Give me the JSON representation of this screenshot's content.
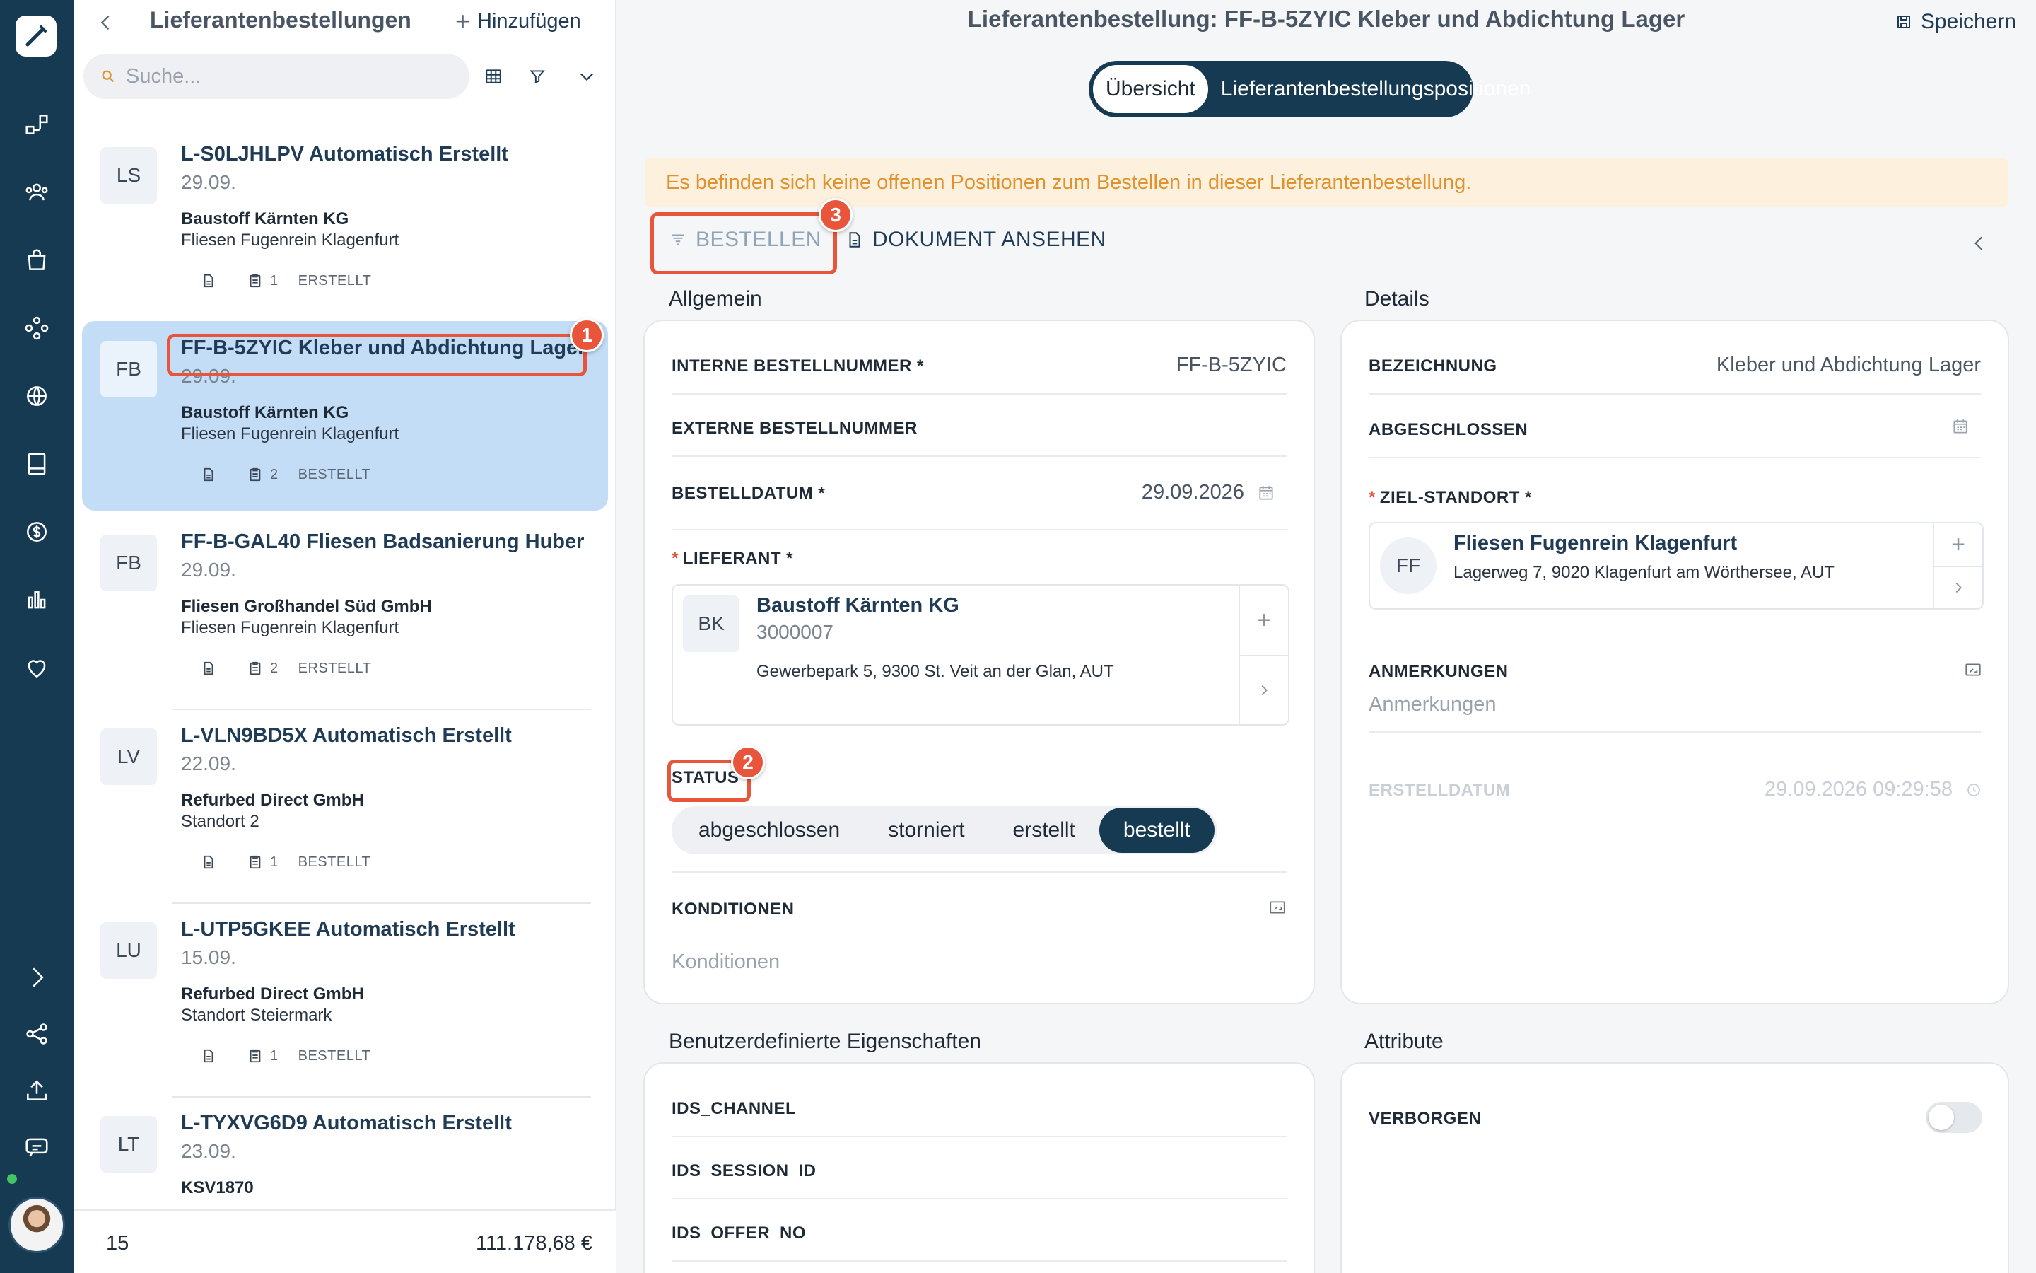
{
  "colors": {
    "rail": "#153a52",
    "accent": "#153a52",
    "selected_row": "#c4ddf7",
    "warning_bg": "#fdf0dd",
    "warning_text": "#e0922e",
    "annotation": "#e8553a",
    "online": "#43c463"
  },
  "rail": {
    "icons": [
      "pen-logo-icon",
      "workflow-icon",
      "users-icon",
      "shopping-bag-icon",
      "network-icon",
      "globe-icon",
      "book-icon",
      "dollar-icon",
      "bar-chart-icon",
      "heart-icon",
      "chevron-right-icon",
      "share-icon",
      "upload-icon",
      "chat-icon"
    ]
  },
  "list": {
    "title": "Lieferantenbestellungen",
    "add_label": "Hinzufügen",
    "search_placeholder": "Suche...",
    "items": [
      {
        "initials": "LS",
        "title": "L-S0LJHLPV Automatisch Erstellt",
        "date": "29.09.",
        "supplier": "Baustoff Kärnten KG",
        "location": "Fliesen Fugenrein Klagenfurt",
        "count": "1",
        "status": "ERSTELLT"
      },
      {
        "initials": "FB",
        "title": "FF-B-5ZYIC Kleber und Abdichtung Lager",
        "date": "29.09.",
        "supplier": "Baustoff Kärnten KG",
        "location": "Fliesen Fugenrein Klagenfurt",
        "count": "2",
        "status": "BESTELLT"
      },
      {
        "initials": "FB",
        "title": "FF-B-GAL40 Fliesen Badsanierung Huber",
        "date": "29.09.",
        "supplier": "Fliesen Großhandel Süd GmbH",
        "location": "Fliesen Fugenrein Klagenfurt",
        "count": "2",
        "status": "ERSTELLT"
      },
      {
        "initials": "LV",
        "title": "L-VLN9BD5X Automatisch Erstellt",
        "date": "22.09.",
        "supplier": "Refurbed Direct GmbH",
        "location": "Standort 2",
        "count": "1",
        "status": "BESTELLT"
      },
      {
        "initials": "LU",
        "title": "L-UTP5GKEE Automatisch Erstellt",
        "date": "15.09.",
        "supplier": "Refurbed Direct GmbH",
        "location": "Standort Steiermark",
        "count": "1",
        "status": "BESTELLT"
      },
      {
        "initials": "LT",
        "title": "L-TYXVG6D9 Automatisch Erstellt",
        "date": "23.09.",
        "supplier": "KSV1870",
        "location": "",
        "count": "",
        "status": ""
      }
    ],
    "footer_count": "15",
    "footer_sum": "111.178,68 €"
  },
  "main": {
    "title": "Lieferantenbestellung: FF-B-5ZYIC Kleber und Abdichtung Lager",
    "save_label": "Speichern",
    "tabs": [
      "Übersicht",
      "Lieferantenbestellungspositionen"
    ],
    "warning": "Es befinden sich keine offenen Positionen zum Bestellen in dieser Lieferantenbestellung.",
    "actions": {
      "order": "BESTELLEN",
      "document": "DOKUMENT ANSEHEN"
    },
    "general": {
      "heading": "Allgemein",
      "internal_no_label": "INTERNE BESTELLNUMMER *",
      "internal_no_value": "FF-B-5ZYIC",
      "external_no_label": "EXTERNE BESTELLNUMMER",
      "order_date_label": "BESTELLDATUM *",
      "order_date_value": "29.09.2026",
      "supplier_label": "LIEFERANT *",
      "supplier": {
        "initials": "BK",
        "name": "Baustoff Kärnten KG",
        "number": "3000007",
        "address": "Gewerbepark 5, 9300 St. Veit an der Glan, AUT"
      },
      "status_label": "STATUS",
      "status_options": [
        "abgeschlossen",
        "storniert",
        "erstellt",
        "bestellt"
      ],
      "status_selected": "bestellt",
      "conditions_label": "KONDITIONEN",
      "conditions_placeholder": "Konditionen"
    },
    "details": {
      "heading": "Details",
      "name_label": "BEZEICHNUNG",
      "name_value": "Kleber und Abdichtung Lager",
      "closed_label": "ABGESCHLOSSEN",
      "target_label": "ZIEL-STANDORT *",
      "target": {
        "initials": "FF",
        "name": "Fliesen Fugenrein Klagenfurt",
        "address": "Lagerweg 7, 9020 Klagenfurt am Wörthersee, AUT"
      },
      "notes_label": "ANMERKUNGEN",
      "notes_placeholder": "Anmerkungen",
      "created_label": "ERSTELLDATUM",
      "created_value": "29.09.2026 09:29:58"
    },
    "custom": {
      "heading": "Benutzerdefinierte Eigenschaften",
      "fields": [
        "IDS_CHANNEL",
        "IDS_SESSION_ID",
        "IDS_OFFER_NO"
      ]
    },
    "attributes": {
      "heading": "Attribute",
      "hidden_label": "VERBORGEN",
      "hidden_value": false
    }
  },
  "annotations": {
    "badge1": "1",
    "badge2": "2",
    "badge3": "3"
  }
}
